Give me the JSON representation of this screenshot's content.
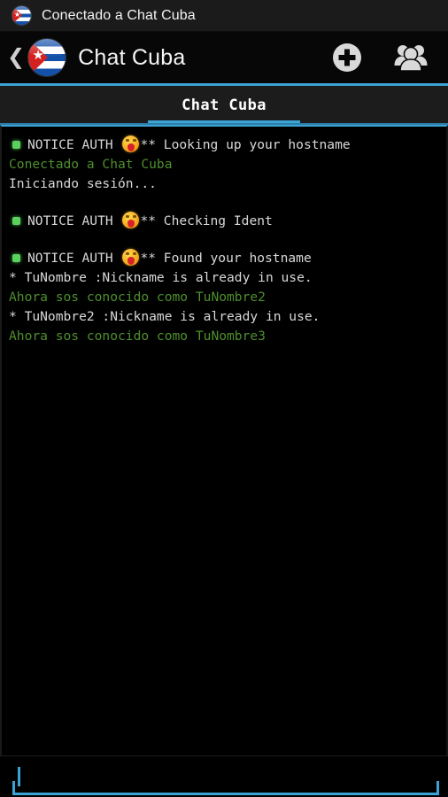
{
  "statusbar": {
    "icon": "cuba-flag-icon",
    "text": "Conectado a Chat Cuba"
  },
  "appbar": {
    "back_icon": "❮",
    "flag_icon": "cuba-flag-icon",
    "title": "Chat Cuba",
    "add_icon": "plus-circle-icon",
    "users_icon": "people-group-icon"
  },
  "tabs": [
    {
      "label": "Chat Cuba",
      "selected": true
    }
  ],
  "chat": {
    "lines": [
      {
        "kind": "notice",
        "bullet": true,
        "prefix": "NOTICE AUTH ",
        "emoji": true,
        "text": "** Looking up your hostname",
        "gap_before": false
      },
      {
        "kind": "system",
        "bullet": false,
        "prefix": "",
        "emoji": false,
        "text": "Conectado a Chat Cuba",
        "gap_before": false
      },
      {
        "kind": "plain",
        "bullet": false,
        "prefix": "",
        "emoji": false,
        "text": "Iniciando sesión...",
        "gap_before": false
      },
      {
        "kind": "notice",
        "bullet": true,
        "prefix": "NOTICE AUTH ",
        "emoji": true,
        "text": "** Checking Ident",
        "gap_before": true
      },
      {
        "kind": "notice",
        "bullet": true,
        "prefix": "NOTICE AUTH ",
        "emoji": true,
        "text": "** Found your hostname",
        "gap_before": true
      },
      {
        "kind": "plain",
        "bullet": false,
        "prefix": "",
        "emoji": false,
        "text": "* TuNombre :Nickname is already in use.",
        "gap_before": false
      },
      {
        "kind": "system",
        "bullet": false,
        "prefix": "",
        "emoji": false,
        "text": "Ahora sos conocido como TuNombre2",
        "gap_before": false
      },
      {
        "kind": "plain",
        "bullet": false,
        "prefix": "",
        "emoji": false,
        "text": "* TuNombre2 :Nickname is already in use.",
        "gap_before": false
      },
      {
        "kind": "system",
        "bullet": false,
        "prefix": "",
        "emoji": false,
        "text": "Ahora sos conocido como TuNombre3",
        "gap_before": false
      }
    ]
  },
  "input": {
    "value": "",
    "placeholder": ""
  },
  "colors": {
    "accent_blue": "#3ba3d6",
    "system_green": "#4e8f2d",
    "bullet_green": "#59d15c",
    "text_gray": "#d8d8d8",
    "statusbar_bg": "#1b1b1b",
    "tabstrip_bg": "#1c1c1c",
    "background": "#000000"
  }
}
